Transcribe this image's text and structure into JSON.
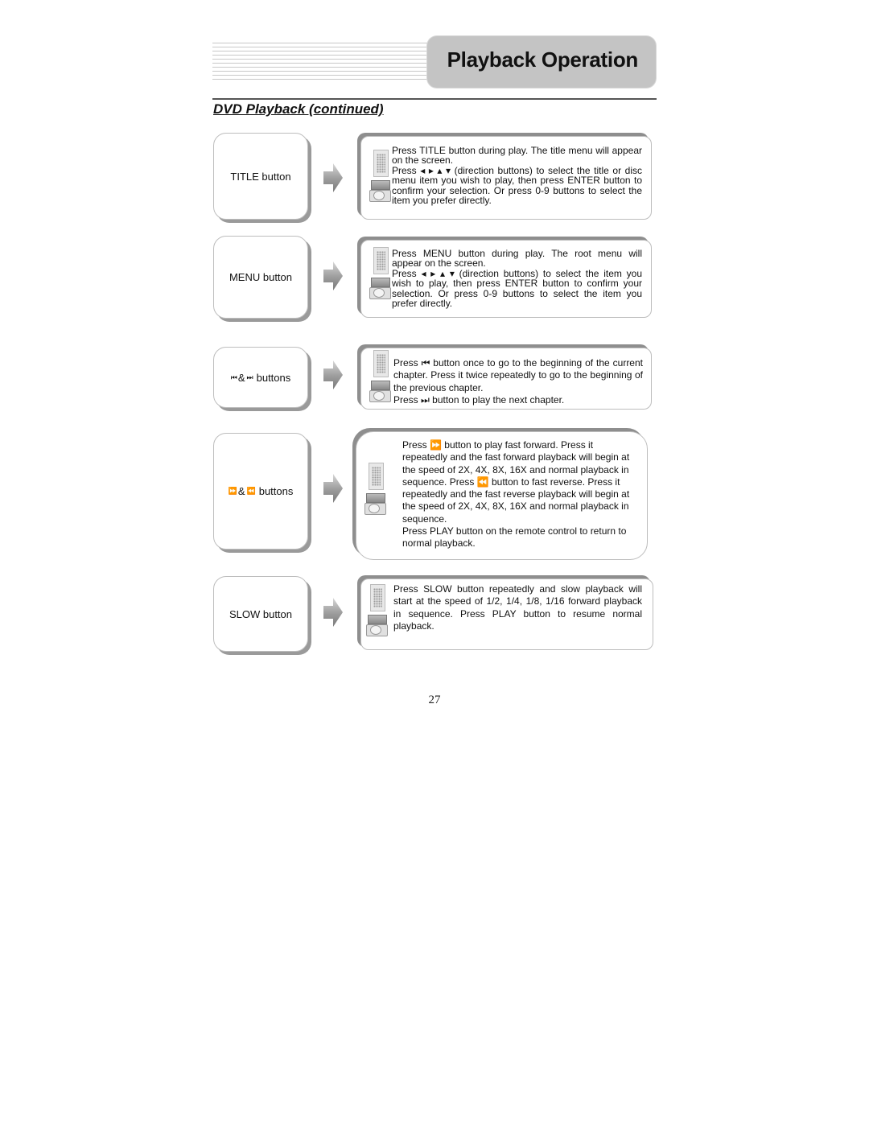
{
  "header": {
    "title": "Playback Operation",
    "section_title": "DVD Playback (continued)"
  },
  "rows": [
    {
      "label": "TITLE button",
      "paragraphs": [
        "Press TITLE button during play. The title menu will appear on the screen.",
        "Press ◂ ▸ ▴ ▾ (direction buttons) to select the title or disc menu item you wish to play, then press ENTER button to confirm your selection. Or press 0-9 buttons to select the item you prefer directly."
      ]
    },
    {
      "label": "MENU button",
      "paragraphs": [
        "Press MENU button during play. The root menu will appear on the screen.",
        "Press ◂ ▸ ▴ ▾ (direction buttons) to select the item you wish to play, then press ENTER button to confirm your selection. Or press 0-9 buttons to select the item you prefer directly."
      ]
    },
    {
      "label_prefix_icon": "skip-back-icon",
      "label_amp": "&",
      "label_suffix_icon": "skip-forward-icon",
      "label": "buttons",
      "paragraphs": [
        "Press ⏮ button once to go to the beginning of the current chapter. Press it twice repeatedly to go to the beginning of the previous chapter.",
        "Press ⏭ button to play the next chapter."
      ]
    },
    {
      "label_prefix_icon": "fast-forward-icon",
      "label_amp": "&",
      "label_suffix_icon": "fast-reverse-icon",
      "label": "buttons",
      "paragraphs": [
        "Press ⏩ button to play fast forward. Press it repeatedly and the fast forward playback will begin at the speed of 2X, 4X, 8X, 16X and normal playback in sequence. Press ⏪ button to fast reverse. Press it repeatedly and the fast reverse playback will begin at the speed of 2X, 4X, 8X, 16X and normal playback in sequence.",
        "Press PLAY button on the remote control to return to normal playback."
      ]
    },
    {
      "label": "SLOW button",
      "paragraphs": [
        "Press SLOW button repeatedly and slow playback will start at the speed of 1/2, 1/4, 1/8, 1/16 forward playback in sequence. Press PLAY button to resume normal playback."
      ]
    }
  ],
  "symbols": {
    "skip_back": "⏮",
    "skip_forward": "⏭",
    "fast_forward": "⏩",
    "fast_reverse": "⏪"
  },
  "page_number": "27"
}
